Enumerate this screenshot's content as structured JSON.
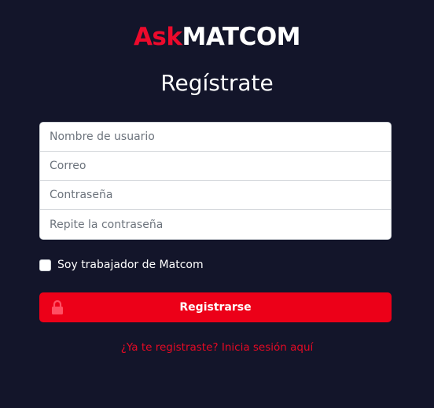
{
  "logo": {
    "ask": "Ask",
    "matcom": "MATCOM"
  },
  "title": "Regístrate",
  "form": {
    "username_placeholder": "Nombre de usuario",
    "email_placeholder": "Correo",
    "password_placeholder": "Contraseña",
    "repeat_password_placeholder": "Repite la contraseña",
    "worker_checkbox_label": "Soy trabajador de Matcom",
    "worker_checked": false,
    "submit_label": "Registrarse",
    "submit_icon": "lock-icon"
  },
  "login_link": "¿Ya te registraste? Inicia sesión aquí",
  "colors": {
    "background": "#13152a",
    "accent": "#ec0018",
    "logo_red": "#ec0a2c",
    "text": "#ffffff"
  }
}
